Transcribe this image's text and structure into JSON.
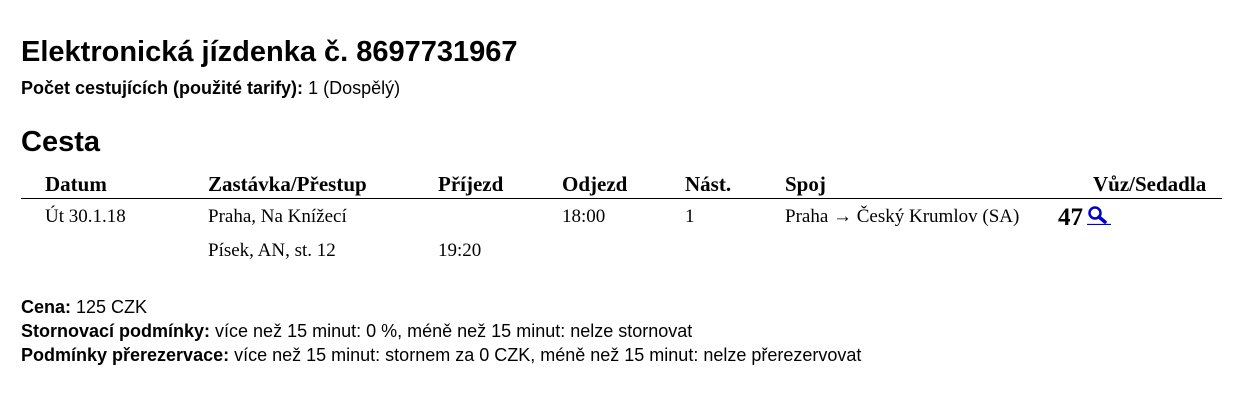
{
  "ticket": {
    "title": "Elektronická jízdenka č. 8697731967",
    "passengers_label": "Počet cestujících (použité tarify):",
    "passengers_value": " 1 (Dospělý)"
  },
  "journey": {
    "title": "Cesta",
    "columns": [
      "Datum",
      "Zastávka/Přestup",
      "Příjezd",
      "Odjezd",
      "Nást.",
      "Spoj",
      "Vůz/Sedadla"
    ],
    "rows": [
      {
        "date": "Út 30.1.18",
        "stop": "Praha, Na Knížecí",
        "arrival": "",
        "departure": "18:00",
        "platform": "1",
        "connection": "Praha → Český Krumlov (SA)",
        "seat": "47",
        "seat_icon": "magnifier-icon"
      },
      {
        "date": "",
        "stop": "Písek, AN, st. 12",
        "arrival": "19:20",
        "departure": "",
        "platform": "",
        "connection": "",
        "seat": ""
      }
    ]
  },
  "price": {
    "label": "Cena:",
    "value": " 125 CZK"
  },
  "cancellation": {
    "label": "Stornovací podmínky:",
    "value": " více než 15 minut: 0 %, méně než 15 minut: nelze stornovat"
  },
  "rebooking": {
    "label": "Podmínky přerezervace:",
    "value": " více než 15 minut: stornem za 0 CZK, méně než 15 minut: nelze přerezervovat"
  },
  "colors": {
    "text": "#000000",
    "link": "#0000cc",
    "background": "#ffffff"
  }
}
